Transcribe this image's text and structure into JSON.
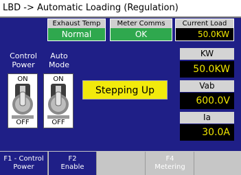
{
  "title": "LBD -> Automatic Loading (Regulation)",
  "status": {
    "exhaust_temp": {
      "label": "Exhaust Temp",
      "value": "Normal"
    },
    "meter_comms": {
      "label": "Meter Comms",
      "value": "OK"
    },
    "current_load": {
      "label": "Current Load",
      "value": "50.0KW"
    }
  },
  "switches": {
    "control_power": {
      "header_line1": "Control",
      "header_line2": "Power",
      "on": "ON",
      "off": "OFF"
    },
    "auto_mode": {
      "header_line1": "Auto",
      "header_line2": "Mode",
      "on": "ON",
      "off": "OFF"
    }
  },
  "banner": "Stepping Up",
  "measurements": [
    {
      "label": "KW",
      "value": "50.0KW"
    },
    {
      "label": "Vab",
      "value": "600.0V"
    },
    {
      "label": "Ia",
      "value": "30.0A"
    }
  ],
  "function_keys": [
    {
      "line1": "F1 - Control",
      "line2": "Power"
    },
    {
      "line1": "F2",
      "line2": "Enable"
    },
    {
      "line1": "",
      "line2": ""
    },
    {
      "line1": "F4",
      "line2": "Metering"
    },
    {
      "line1": "",
      "line2": ""
    }
  ],
  "colors": {
    "screen_bg": "#1f1f87",
    "status_ok": "#2fa84e",
    "banner": "#f2ea0c",
    "value_text": "#f0e600"
  }
}
